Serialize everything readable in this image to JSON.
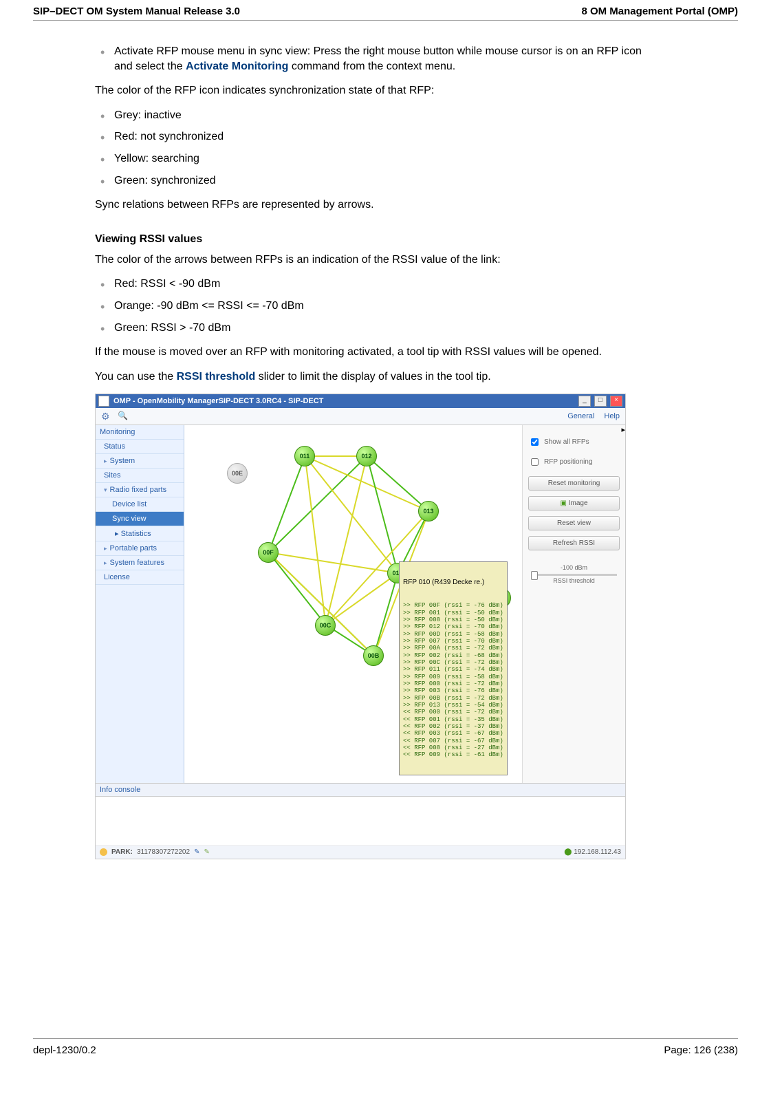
{
  "header": {
    "left": "SIP–DECT OM System Manual Release 3.0",
    "right": "8 OM Management Portal (OMP)"
  },
  "footer": {
    "left": "depl-1230/0.2",
    "right": "Page: 126 (238)"
  },
  "body": {
    "activate_item": "Activate RFP mouse menu in sync view: Press the right mouse button while mouse cursor is on an RFP icon and select the ",
    "activate_bold": "Activate Monitoring",
    "activate_tail": " command from the context menu.",
    "color_intro": "The color of the RFP icon indicates synchronization state of that RFP:",
    "colors": {
      "grey": "Grey: inactive",
      "red": "Red: not synchronized",
      "yellow": "Yellow: searching",
      "green": "Green: synchronized"
    },
    "sync_arrows": "Sync relations between RFPs are represented by arrows.",
    "rssi_heading": "Viewing RSSI values",
    "rssi_intro": "The color of the arrows between RFPs is an indication of the RSSI value of the link:",
    "rssi": {
      "red": "Red: RSSI < -90 dBm",
      "orange": "Orange: -90 dBm <= RSSI <= -70 dBm",
      "green": "Green: RSSI > -70 dBm"
    },
    "mouse_tip": "If the mouse is moved over an RFP with monitoring activated, a tool tip with RSSI values will be opened.",
    "slider_pre": "You can use the ",
    "slider_bold": "RSSI threshold",
    "slider_tail": " slider to limit the display of values in the tool tip."
  },
  "app": {
    "title": "OMP - OpenMobility ManagerSIP-DECT 3.0RC4 - SIP-DECT",
    "menu": {
      "general": "General",
      "help": "Help"
    },
    "nav": {
      "monitoring": "Monitoring",
      "status": "Status",
      "system": "System",
      "sites": "Sites",
      "radio": "Radio fixed parts",
      "device": "Device list",
      "sync": "Sync view",
      "stats": "Statistics",
      "portable": "Portable parts",
      "sysfeat": "System features",
      "license": "License"
    },
    "side": {
      "show_all": "Show all RFPs",
      "rfp_pos": "RFP positioning",
      "reset_mon": "Reset monitoring",
      "image": "Image",
      "reset_view": "Reset view",
      "refresh_rssi": "Refresh RSSI",
      "slider_val": "-100 dBm",
      "slider_cap": "RSSI threshold"
    },
    "nodes": {
      "n00E": "00E",
      "n011": "011",
      "n012": "012",
      "n013": "013",
      "n00F": "00F",
      "n00Fr": "00F",
      "n00C": "00C",
      "n00B": "00B",
      "n010": "010"
    },
    "tooltip": {
      "head": "RFP 010 (R439 Decke re.)",
      "lines": [
        ">> RFP 00F (rssi = -76 dBm)",
        ">> RFP 001 (rssi = -50 dBm)",
        ">> RFP 008 (rssi = -50 dBm)",
        ">> RFP 012 (rssi = -70 dBm)",
        ">> RFP 00D (rssi = -58 dBm)",
        ">> RFP 007 (rssi = -70 dBm)",
        ">> RFP 00A (rssi = -72 dBm)",
        ">> RFP 002 (rssi = -68 dBm)",
        ">> RFP 00C (rssi = -72 dBm)",
        ">> RFP 011 (rssi = -74 dBm)",
        ">> RFP 009 (rssi = -58 dBm)",
        ">> RFP 000 (rssi = -72 dBm)",
        ">> RFP 003 (rssi = -76 dBm)",
        ">> RFP 00B (rssi = -72 dBm)",
        ">> RFP 013 (rssi = -54 dBm)",
        "<< RFP 000 (rssi = -72 dBm)",
        "<< RFP 001 (rssi = -35 dBm)",
        "<< RFP 002 (rssi = -37 dBm)",
        "<< RFP 003 (rssi = -67 dBm)",
        "<< RFP 007 (rssi = -67 dBm)",
        "<< RFP 008 (rssi = -27 dBm)",
        "<< RFP 009 (rssi = -61 dBm)"
      ]
    },
    "info_console": "Info console",
    "status": {
      "park_label": "PARK:",
      "park": "31178307272202",
      "ip": "192.168.112.43"
    }
  }
}
